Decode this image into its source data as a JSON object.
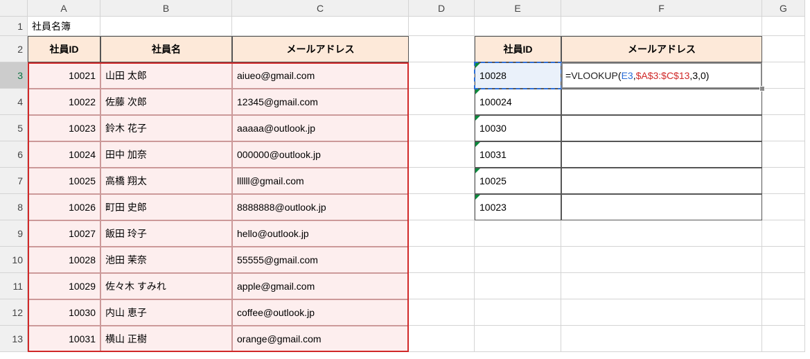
{
  "columns": [
    "A",
    "B",
    "C",
    "D",
    "E",
    "F",
    "G"
  ],
  "rows": [
    "1",
    "2",
    "3",
    "4",
    "5",
    "6",
    "7",
    "8",
    "9",
    "10",
    "11",
    "12",
    "13"
  ],
  "title_cell": "社員名簿",
  "left_headers": {
    "id": "社員ID",
    "name": "社員名",
    "mail": "メールアドレス"
  },
  "right_headers": {
    "id": "社員ID",
    "mail": "メールアドレス"
  },
  "left_rows": [
    {
      "id": "10021",
      "name": "山田 太郎",
      "mail": "aiueo@gmail.com"
    },
    {
      "id": "10022",
      "name": "佐藤 次郎",
      "mail": "12345@gmail.com"
    },
    {
      "id": "10023",
      "name": "鈴木 花子",
      "mail": "aaaaa@outlook.jp"
    },
    {
      "id": "10024",
      "name": "田中 加奈",
      "mail": "000000@outlook.jp"
    },
    {
      "id": "10025",
      "name": "高橋 翔太",
      "mail": "llllll@gmail.com"
    },
    {
      "id": "10026",
      "name": "町田 史郎",
      "mail": "8888888@outlook.jp"
    },
    {
      "id": "10027",
      "name": "飯田 玲子",
      "mail": "hello@outlook.jp"
    },
    {
      "id": "10028",
      "name": "池田 茉奈",
      "mail": "55555@gmail.com"
    },
    {
      "id": "10029",
      "name": "佐々木 すみれ",
      "mail": "apple@gmail.com"
    },
    {
      "id": "10030",
      "name": "内山 恵子",
      "mail": "coffee@outlook.jp"
    },
    {
      "id": "10031",
      "name": "横山 正樹",
      "mail": "orange@gmail.com"
    }
  ],
  "right_rows": [
    {
      "id": "10028",
      "mail": ""
    },
    {
      "id": "100024",
      "mail": ""
    },
    {
      "id": "10030",
      "mail": ""
    },
    {
      "id": "10031",
      "mail": ""
    },
    {
      "id": "10025",
      "mail": ""
    },
    {
      "id": "10023",
      "mail": ""
    }
  ],
  "formula": {
    "eq": "=",
    "fn": "VLOOKUP",
    "open": "(",
    "arg1": "E3",
    "c1": ",",
    "arg2": "$A$3:$C$13",
    "c2": ",",
    "arg3": "3",
    "c3": ",",
    "arg4": "0",
    "close": ")"
  }
}
